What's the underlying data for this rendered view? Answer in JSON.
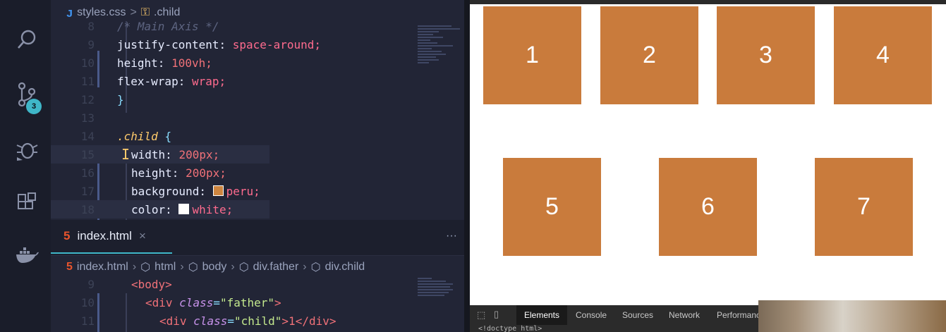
{
  "activity_bar": {
    "badge": "3",
    "icons": [
      "search-icon",
      "source-control-icon",
      "debug-icon",
      "extensions-icon",
      "docker-icon"
    ]
  },
  "editor_top": {
    "breadcrumb": {
      "file": "styles.css",
      "sep": ">",
      "symbol": ".child"
    },
    "lines": [
      {
        "n": "8",
        "text": "/* Main Axis */"
      },
      {
        "n": "9",
        "prop": "justify-content:",
        "val": "space-around;"
      },
      {
        "n": "10",
        "prop": "height:",
        "val": "100vh;"
      },
      {
        "n": "11",
        "prop": "flex-wrap:",
        "val": "wrap;"
      },
      {
        "n": "12",
        "text": "}"
      },
      {
        "n": "13",
        "text": ""
      },
      {
        "n": "14",
        "selector": ".child",
        "brace": "{"
      },
      {
        "n": "15",
        "prop": "width:",
        "val": "200px;"
      },
      {
        "n": "16",
        "prop": "height:",
        "val": "200px;"
      },
      {
        "n": "17",
        "prop": "background:",
        "val": "peru;",
        "swatch": "#cd853f"
      },
      {
        "n": "18",
        "prop": "color:",
        "val": "white;",
        "swatch": "#ffffff"
      }
    ]
  },
  "editor_bottom": {
    "tab": {
      "label": "index.html",
      "close": "×"
    },
    "more": "···",
    "breadcrumb": [
      "index.html",
      "html",
      "body",
      "div.father",
      "div.child"
    ],
    "lines": [
      {
        "n": "9",
        "tag_open": "<body>"
      },
      {
        "n": "10",
        "pre": "<div ",
        "attr": "class",
        "eq": "=",
        "str": "\"father\"",
        "post": ">"
      },
      {
        "n": "11",
        "pre": "<div ",
        "attr": "class",
        "eq": "=",
        "str": "\"child\"",
        "post": ">1</div>"
      }
    ]
  },
  "browser": {
    "boxes": [
      "1",
      "2",
      "3",
      "4",
      "5",
      "6",
      "7"
    ],
    "box_color": "#c97b3c",
    "devtools": {
      "tabs": [
        "Elements",
        "Console",
        "Sources",
        "Network",
        "Performanc"
      ],
      "doctype": "<!doctype html>"
    }
  }
}
